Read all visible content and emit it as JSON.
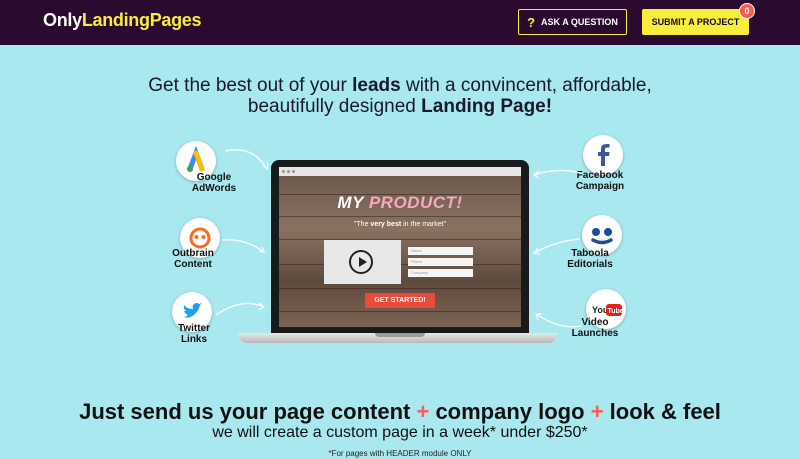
{
  "header": {
    "logo_prefix": "Only",
    "logo_accent": "LandingPages",
    "ask_icon": "?",
    "ask_label": "ASK A QUESTION",
    "submit_label": "SUBMIT A PROJECT",
    "badge_count": "0"
  },
  "hero": {
    "line1_pre": "Get the best out of your ",
    "line1_bold": "leads",
    "line1_post": " with a convincent, affordable,",
    "line2_pre": "beautifully designed ",
    "line2_bold": "Landing Page!"
  },
  "mockup": {
    "title_white": "MY ",
    "title_pink": "PRODUCT!",
    "sub_pre": "\"The ",
    "sub_bold1": "very best",
    "sub_mid": " in the ",
    "sub_post": "market\"",
    "field1": "Name",
    "field2": "Phone",
    "field3": "Company",
    "cta": "GET STARTED!"
  },
  "channels": {
    "google": {
      "line1": "Google",
      "line2": "AdWords",
      "icon": "google-adwords-icon"
    },
    "outbrain": {
      "line1": "Outbrain",
      "line2": "Content",
      "icon": "outbrain-icon"
    },
    "twitter": {
      "line1": "Twitter",
      "line2": "Links",
      "icon": "twitter-icon"
    },
    "facebook": {
      "line1": "Facebook",
      "line2": "Campaign",
      "icon": "facebook-icon"
    },
    "taboola": {
      "line1": "Taboola",
      "line2": "Editorials",
      "icon": "taboola-icon"
    },
    "youtube": {
      "line1": "Video",
      "line2": "Launches",
      "icon": "youtube-icon",
      "logo_you": "You",
      "logo_tube": "Tube"
    }
  },
  "bottom": {
    "part1": "Just send us your page content ",
    "plus": "+",
    "part2": " company logo ",
    "part3": " look & feel",
    "sub": "we will create a custom page in a week* under $250*",
    "footnote": "*For pages with HEADER module ONLY"
  },
  "colors": {
    "header_bg": "#2a0a2e",
    "page_bg": "#a8e8ee",
    "accent_yellow": "#f6ee3a",
    "accent_red": "#ff5a4f"
  }
}
